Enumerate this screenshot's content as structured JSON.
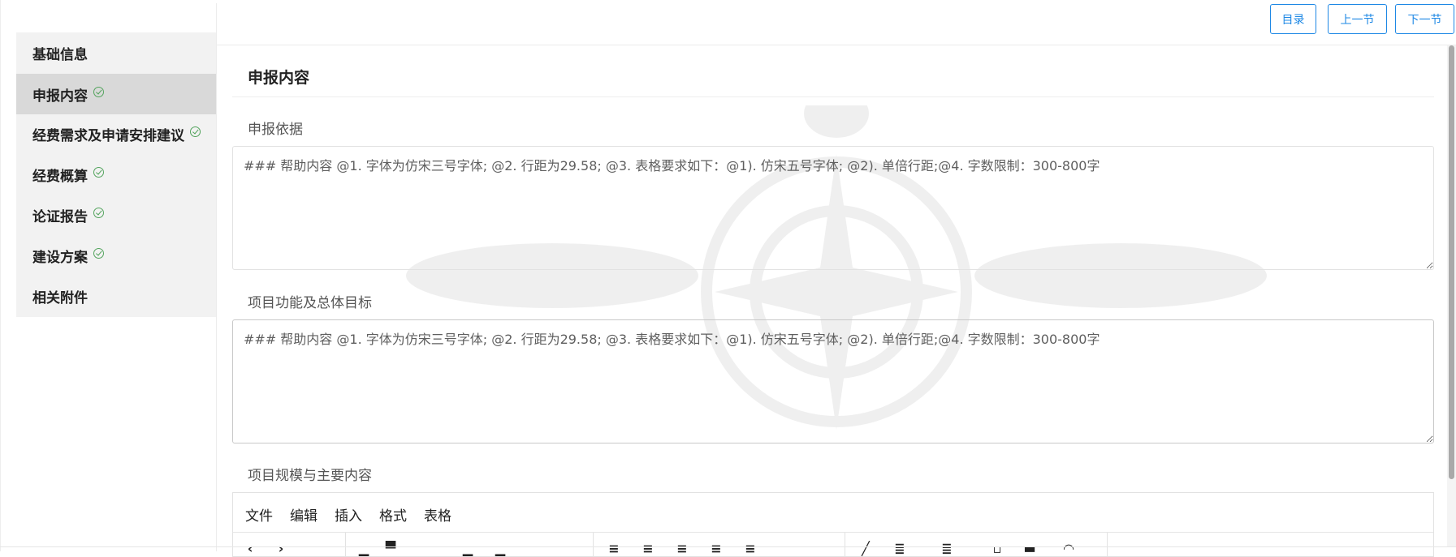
{
  "toolbar": {
    "catalog_label": "目录",
    "prev_label": "上一节",
    "next_label": "下一节"
  },
  "sidebar": {
    "items": [
      {
        "label": "基础信息",
        "done": false,
        "active": false
      },
      {
        "label": "申报内容",
        "done": true,
        "active": true
      },
      {
        "label": "经费需求及申请安排建议",
        "done": true,
        "active": false
      },
      {
        "label": "经费概算",
        "done": true,
        "active": false
      },
      {
        "label": "论证报告",
        "done": true,
        "active": false
      },
      {
        "label": "建设方案",
        "done": true,
        "active": false
      },
      {
        "label": "相关附件",
        "done": false,
        "active": false
      }
    ]
  },
  "main": {
    "section_title": "申报内容",
    "fields": [
      {
        "label": "申报依据",
        "value": "",
        "placeholder": "### 帮助内容 @1. 字体为仿宋三号字体; @2. 行距为29.58; @3. 表格要求如下：@1). 仿宋五号字体; @2). 单倍行距;@4. 字数限制：300-800字"
      },
      {
        "label": "项目功能及总体目标",
        "value": "",
        "placeholder": "### 帮助内容 @1. 字体为仿宋三号字体; @2. 行距为29.58; @3. 表格要求如下：@1). 仿宋五号字体; @2). 单倍行距;@4. 字数限制：300-800字"
      },
      {
        "label": "项目规模与主要内容"
      }
    ],
    "editor": {
      "menus": [
        "文件",
        "编辑",
        "插入",
        "格式",
        "表格"
      ]
    }
  },
  "colors": {
    "accent": "#1e88e5",
    "check": "#52a35c",
    "sidebar_bg": "#f2f2f2",
    "sidebar_active_bg": "#d9d9d9"
  },
  "icons": {
    "done": "check-circle-icon"
  }
}
